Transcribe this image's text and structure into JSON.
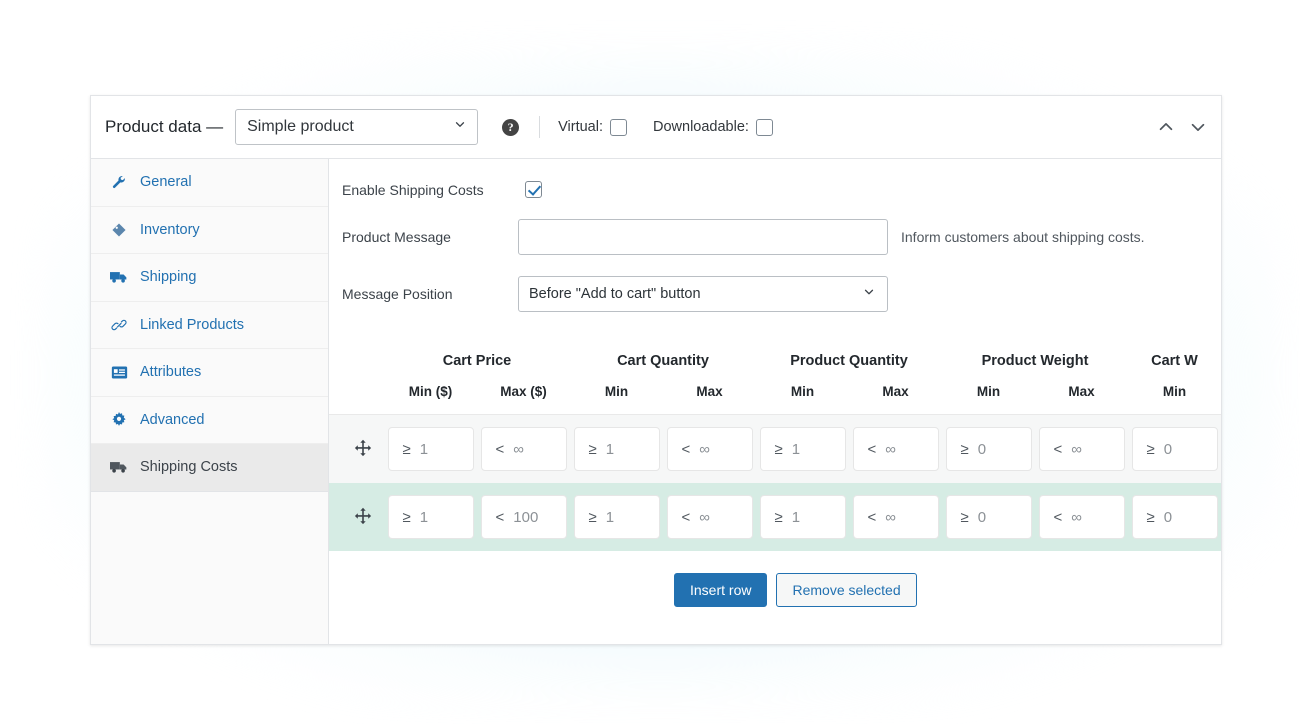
{
  "header": {
    "title": "Product data —",
    "product_type": "Simple product",
    "help_icon": "question-mark-circle-icon",
    "virtual_label": "Virtual:",
    "virtual_checked": false,
    "downloadable_label": "Downloadable:",
    "downloadable_checked": false,
    "collapse_up_icon": "chevron-up-icon",
    "collapse_down_icon": "chevron-down-icon"
  },
  "sidebar": {
    "items": [
      {
        "label": "General",
        "icon": "wrench-icon",
        "active": false
      },
      {
        "label": "Inventory",
        "icon": "tag-icon",
        "active": false
      },
      {
        "label": "Shipping",
        "icon": "truck-icon",
        "active": false
      },
      {
        "label": "Linked Products",
        "icon": "link-icon",
        "active": false
      },
      {
        "label": "Attributes",
        "icon": "list-icon",
        "active": false
      },
      {
        "label": "Advanced",
        "icon": "gear-icon",
        "active": false
      },
      {
        "label": "Shipping Costs",
        "icon": "truck-dark-icon",
        "active": true
      }
    ]
  },
  "form": {
    "enable_label": "Enable Shipping Costs",
    "enable_checked": true,
    "message_label": "Product Message",
    "message_value": "",
    "message_placeholder": "",
    "message_help": "Inform customers about shipping costs.",
    "position_label": "Message Position",
    "position_value": "Before \"Add to cart\" button"
  },
  "table": {
    "groups": [
      {
        "title": "Cart Price",
        "sub": [
          "Min ($)",
          "Max ($)"
        ]
      },
      {
        "title": "Cart Quantity",
        "sub": [
          "Min",
          "Max"
        ]
      },
      {
        "title": "Product Quantity",
        "sub": [
          "Min",
          "Max"
        ]
      },
      {
        "title": "Product Weight",
        "sub": [
          "Min",
          "Max"
        ]
      },
      {
        "title": "Cart W",
        "sub": [
          "Min"
        ]
      }
    ],
    "rows": [
      {
        "selected": false,
        "handle_icon": "move-arrows-icon",
        "cells": [
          {
            "op": "≥",
            "val": "1"
          },
          {
            "op": "<",
            "val": "∞"
          },
          {
            "op": "≥",
            "val": "1"
          },
          {
            "op": "<",
            "val": "∞"
          },
          {
            "op": "≥",
            "val": "1"
          },
          {
            "op": "<",
            "val": "∞"
          },
          {
            "op": "≥",
            "val": "0"
          },
          {
            "op": "<",
            "val": "∞"
          },
          {
            "op": "≥",
            "val": "0"
          }
        ]
      },
      {
        "selected": true,
        "handle_icon": "move-arrows-icon",
        "cells": [
          {
            "op": "≥",
            "val": "1"
          },
          {
            "op": "<",
            "val": "100"
          },
          {
            "op": "≥",
            "val": "1"
          },
          {
            "op": "<",
            "val": "∞"
          },
          {
            "op": "≥",
            "val": "1"
          },
          {
            "op": "<",
            "val": "∞"
          },
          {
            "op": "≥",
            "val": "0"
          },
          {
            "op": "<",
            "val": "∞"
          },
          {
            "op": "≥",
            "val": "0"
          }
        ]
      }
    ]
  },
  "footer": {
    "insert_label": "Insert row",
    "remove_label": "Remove selected"
  },
  "colors": {
    "accent": "#2271b1",
    "link": "#2271b1",
    "row_alt": "#f6f7f7",
    "row_selected": "#d6ece4",
    "tab_active_bg": "#eaeaea",
    "panel_border": "#e2e4e7"
  }
}
